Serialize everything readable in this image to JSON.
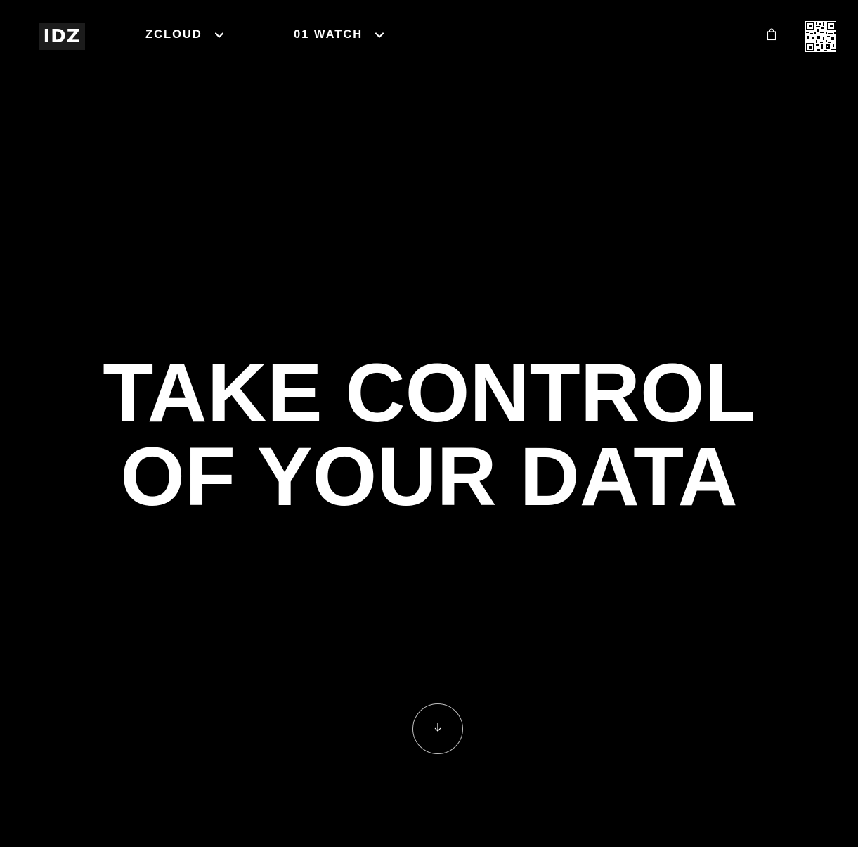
{
  "header": {
    "logo_text": "IDZ",
    "nav": [
      {
        "label": "ZCLOUD",
        "icon": "chevron-down-icon"
      },
      {
        "label": "01 WATCH",
        "icon": "chevron-down-icon"
      }
    ],
    "cart_icon": "shopping-bag-icon",
    "qr_icon": "qr-code-icon"
  },
  "hero": {
    "line1": "TAKE CONTROL",
    "line2": "OF YOUR DATA"
  },
  "scroll": {
    "icon": "arrow-down-icon"
  },
  "colors": {
    "background": "#000000",
    "text": "#ffffff",
    "logo_bg": "#1c1c1c"
  }
}
